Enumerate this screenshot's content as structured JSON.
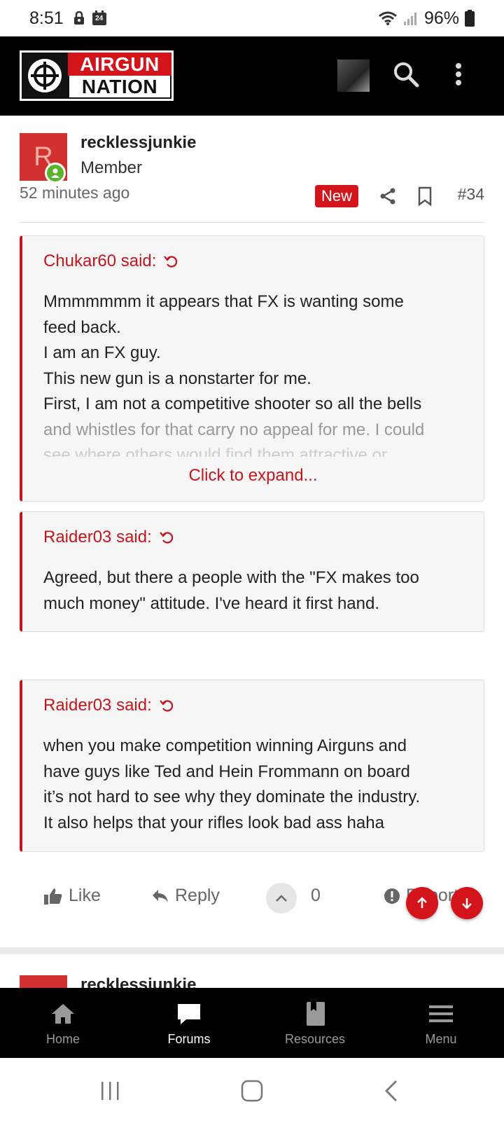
{
  "status_bar": {
    "time": "8:51",
    "calendar_day": "24",
    "battery": "96%"
  },
  "header": {
    "logo_line1": "AIRGUN",
    "logo_line2": "NATION",
    "brand_color": "#d4141b"
  },
  "post": {
    "avatar_letter": "R",
    "username": "recklessjunkie",
    "user_title": "Member",
    "time_ago": "52 minutes ago",
    "badge": "New",
    "post_number": "#34"
  },
  "quotes": [
    {
      "author": "Chukar60 said:",
      "lines": [
        "Mmmmmmm it appears that FX is wanting some",
        "feed back.",
        "I am an FX guy.",
        "This new gun is a nonstarter for me.",
        "First, I am not a competitive shooter so all the bells",
        "and whistles for that carry no appeal for me. I could",
        "see where others would find them attractive or"
      ],
      "expand_label": "Click to expand..."
    },
    {
      "author": "Raider03 said:",
      "lines": [
        "Agreed, but there a people with the \"FX makes too",
        "much money\" attitude. I've heard it first hand."
      ]
    },
    {
      "author": "Raider03 said:",
      "lines": [
        "when you make competition winning Airguns and",
        "have guys like Ted and Hein Frommann on board",
        "it’s not hard to see why they dominate the industry.",
        "It also helps that your rifles look bad ass haha"
      ]
    }
  ],
  "actions": {
    "like": "Like",
    "reply": "Reply",
    "vote_count": "0",
    "report": "Report"
  },
  "next_post": {
    "username": "recklessjunkie"
  },
  "bottom_nav": [
    {
      "label": "Home",
      "icon": "home-icon",
      "active": false
    },
    {
      "label": "Forums",
      "icon": "forums-icon",
      "active": true
    },
    {
      "label": "Resources",
      "icon": "resources-icon",
      "active": false
    },
    {
      "label": "Menu",
      "icon": "menu-icon",
      "active": false
    }
  ]
}
